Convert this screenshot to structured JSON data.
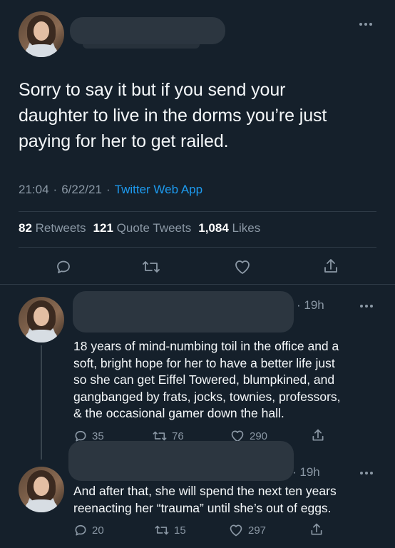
{
  "main_tweet": {
    "text_lines": [
      "Sorry to say it but if you send your",
      "daughter to live in the dorms you’re just",
      "paying for her to get railed."
    ],
    "time": "21:04",
    "date": "6/22/21",
    "separator": "·",
    "source": "Twitter Web App",
    "retweets_count": "82",
    "retweets_label": "Retweets",
    "quotes_count": "121",
    "quotes_label": "Quote Tweets",
    "likes_count": "1,084",
    "likes_label": "Likes"
  },
  "replies": [
    {
      "time": "· 19h",
      "text_lines": [
        "18 years of mind-numbing toil in the office and a",
        "soft, bright hope for her to have a better life just",
        "so she can get Eiffel Towered, blumpkined, and",
        "gangbanged by frats, jocks, townies, professors,",
        "& the occasional gamer down the hall."
      ],
      "reply_count": "35",
      "retweet_count": "76",
      "like_count": "290"
    },
    {
      "time": "· 19h",
      "text_lines": [
        "And after that, she will spend the next ten years",
        "reenacting her “trauma” until she’s out of eggs."
      ],
      "reply_count": "20",
      "retweet_count": "15",
      "like_count": "297"
    }
  ],
  "icons": {
    "more": "more-dots-icon",
    "reply": "speech-bubble-icon",
    "retweet": "retweet-arrows-icon",
    "like": "heart-icon",
    "share": "share-upload-icon"
  },
  "colors": {
    "background": "#15202b",
    "accent": "#1d9bf0",
    "muted": "#8b98a5"
  }
}
